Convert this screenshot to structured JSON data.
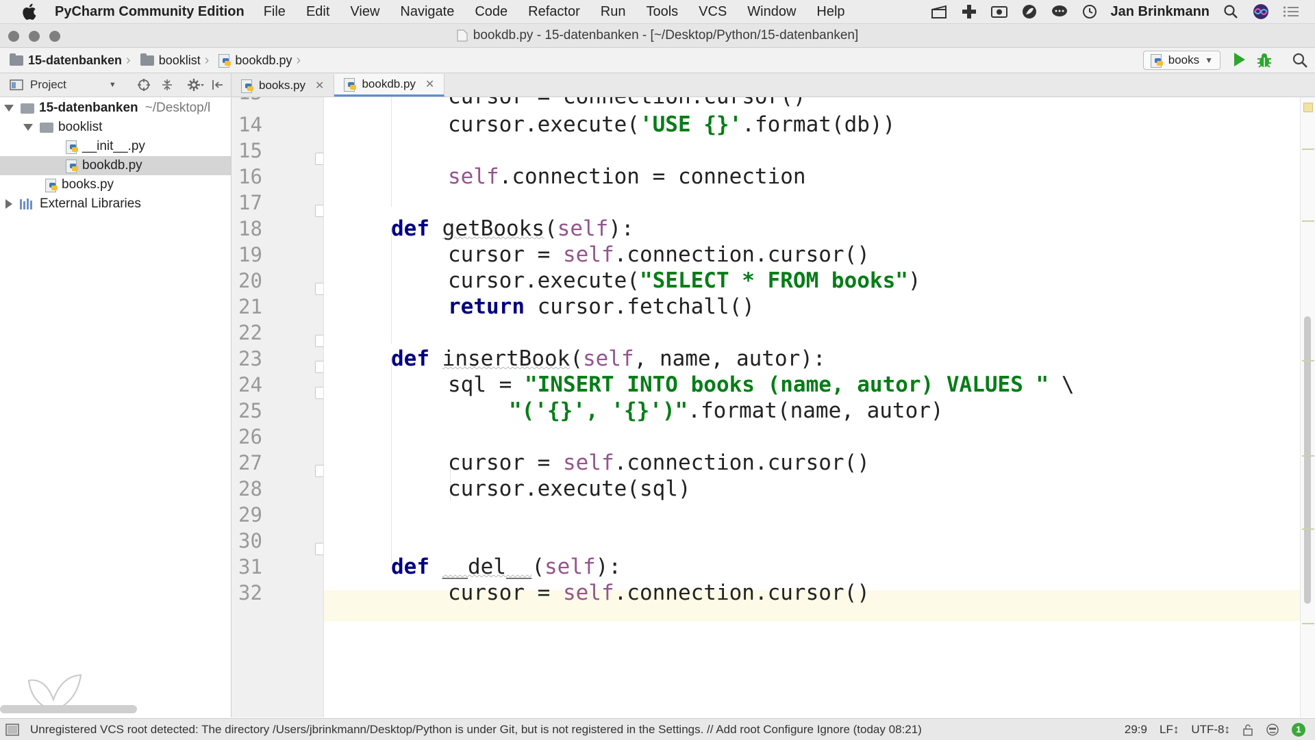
{
  "menubar": {
    "app_name": "PyCharm Community Edition",
    "items": [
      "File",
      "Edit",
      "View",
      "Navigate",
      "Code",
      "Refactor",
      "Run",
      "Tools",
      "VCS",
      "Window",
      "Help"
    ],
    "user": "Jan Brinkmann"
  },
  "window": {
    "title": "bookdb.py - 15-datenbanken - [~/Desktop/Python/15-datenbanken]"
  },
  "breadcrumb": [
    "15-datenbanken",
    "booklist",
    "bookdb.py"
  ],
  "run_config": {
    "name": "books"
  },
  "project_panel": {
    "header": "Project",
    "tree": [
      {
        "label": "15-datenbanken",
        "path": "~/Desktop/l",
        "kind": "folder",
        "expanded": true,
        "depth": 0
      },
      {
        "label": "booklist",
        "kind": "folder",
        "expanded": true,
        "depth": 1
      },
      {
        "label": "__init__.py",
        "kind": "py",
        "depth": 2
      },
      {
        "label": "bookdb.py",
        "kind": "py",
        "depth": 2,
        "selected": true
      },
      {
        "label": "books.py",
        "kind": "py",
        "depth": 1
      },
      {
        "label": "External Libraries",
        "kind": "lib",
        "depth": 0
      }
    ]
  },
  "tabs": [
    {
      "label": "books.py",
      "active": false
    },
    {
      "label": "bookdb.py",
      "active": true
    }
  ],
  "editor": {
    "first_line_partial": 13,
    "current_line": 29,
    "lines": [
      {
        "n": 14,
        "code": "cursor.execute('USE {}'.format(db))"
      },
      {
        "n": 15,
        "code": ""
      },
      {
        "n": 16,
        "code": "self.connection = connection"
      },
      {
        "n": 17,
        "code": ""
      },
      {
        "n": 18,
        "code": "def getBooks(self):"
      },
      {
        "n": 19,
        "code": "cursor = self.connection.cursor()"
      },
      {
        "n": 20,
        "code": "cursor.execute(\"SELECT * FROM books\")"
      },
      {
        "n": 21,
        "code": "return cursor.fetchall()"
      },
      {
        "n": 22,
        "code": ""
      },
      {
        "n": 23,
        "code": "def insertBook(self, name, autor):"
      },
      {
        "n": 24,
        "code": "sql = \"INSERT INTO books (name, autor) VALUES \" \\"
      },
      {
        "n": 25,
        "code": "\"('{}', '{}')\".format(name, autor)"
      },
      {
        "n": 26,
        "code": ""
      },
      {
        "n": 27,
        "code": "cursor = self.connection.cursor()"
      },
      {
        "n": 28,
        "code": "cursor.execute(sql)"
      },
      {
        "n": 29,
        "code": ""
      },
      {
        "n": 30,
        "code": ""
      },
      {
        "n": 31,
        "code": "def __del__(self):"
      },
      {
        "n": 32,
        "code": "cursor = self.connection.cursor()"
      }
    ]
  },
  "statusbar": {
    "message": "Unregistered VCS root detected: The directory /Users/jbrinkmann/Desktop/Python is under Git, but is not registered in the Settings. // Add root  Configure  Ignore (today 08:21)",
    "position": "29:9",
    "line_sep": "LF↕",
    "encoding": "UTF-8↕",
    "events": "1"
  },
  "colors": {
    "keyword": "#000080",
    "self": "#94558d",
    "string": "#067d17",
    "current_line": "#fdfbe7",
    "run": "#2ea62e"
  }
}
